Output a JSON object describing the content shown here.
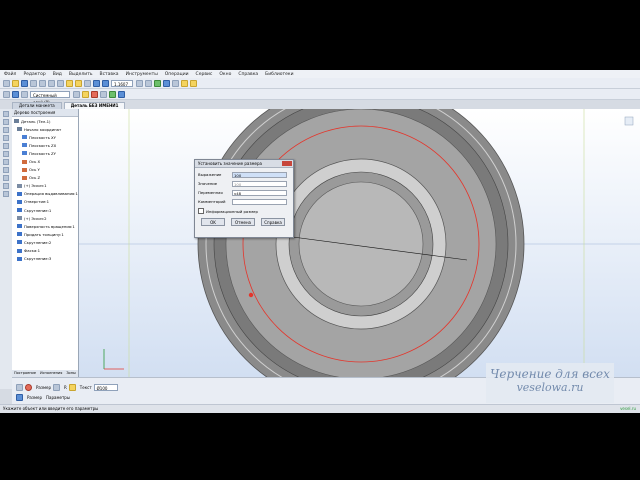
{
  "menu": {
    "items": [
      "Файл",
      "Редактор",
      "Вид",
      "Выделить",
      "Вставка",
      "Инструменты",
      "Операции",
      "Сервис",
      "Окно",
      "Справка",
      "Библиотеки"
    ]
  },
  "toolbar": {
    "layer_select": "Системный слой (0)",
    "scale_value": "1.1607"
  },
  "tabs": [
    {
      "label": "Детали манжета"
    },
    {
      "label": "Деталь БЕЗ ИМЕНИ1"
    }
  ],
  "tree": {
    "header": "Дерево построения",
    "nodes": [
      {
        "label": "Деталь (Тел-1)"
      },
      {
        "label": "Начало координат"
      },
      {
        "label": "Плоскость XY"
      },
      {
        "label": "Плоскость ZX"
      },
      {
        "label": "Плоскость ZY"
      },
      {
        "label": "Ось X"
      },
      {
        "label": "Ось Y"
      },
      {
        "label": "Ось Z"
      },
      {
        "label": "(+) Эскиз:1"
      },
      {
        "label": "Операция выдавливания:1"
      },
      {
        "label": "Отверстие:1"
      },
      {
        "label": "Скругление:1"
      },
      {
        "label": "(+) Эскиз:2"
      },
      {
        "label": "Поверхность вращения:1"
      },
      {
        "label": "Придать толщину:1"
      },
      {
        "label": "Скругление:2"
      },
      {
        "label": "Фаска:1"
      },
      {
        "label": "Скругление:3"
      }
    ],
    "tabs": [
      "Построение",
      "Исполнения",
      "Зоны"
    ]
  },
  "dialog": {
    "title": "Установить значение размера",
    "fields": [
      {
        "label": "Выражение",
        "value": "100"
      },
      {
        "label": "Значение",
        "value": "100"
      },
      {
        "label": "Переменная",
        "value": "v48"
      },
      {
        "label": "Комментарий",
        "value": ""
      }
    ],
    "checkbox_label": "Информационный размер",
    "buttons": [
      "OK",
      "Отмена",
      "Справка"
    ]
  },
  "props": {
    "row1": {
      "dim_label": "Размер",
      "text_label": "Текст",
      "text_value": "Ø100",
      "r_label": "R"
    },
    "tabs": [
      "Размер",
      "Параметры"
    ]
  },
  "status": {
    "text": "Укажите объект или введите его параметры",
    "right": "vesel.ru"
  },
  "watermark": {
    "line1": "Черчение для всех",
    "line2": "veselowa.ru"
  },
  "colors": {
    "accent": "#e4352b",
    "viewport_top": "#ffffff",
    "viewport_bottom": "#d2dff2"
  }
}
